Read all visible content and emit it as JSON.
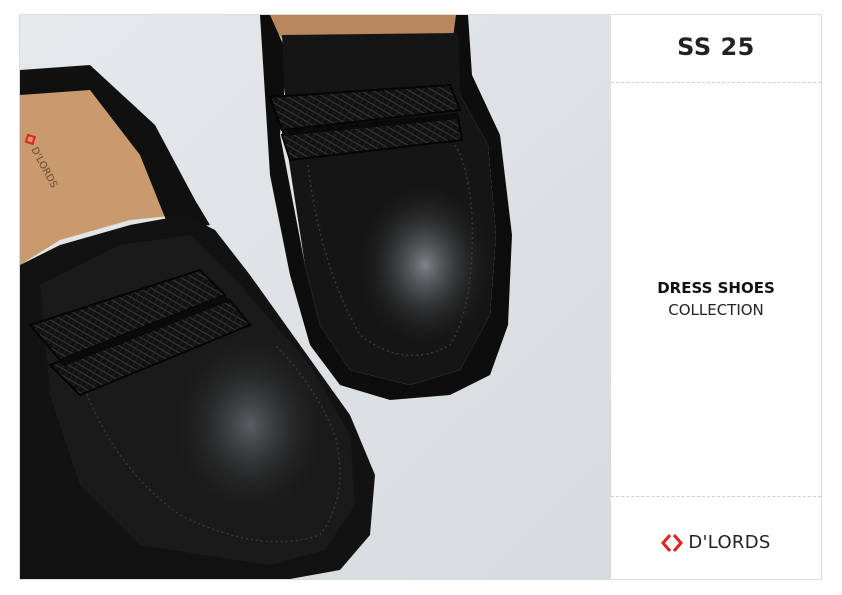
{
  "panel": {
    "season": "SS 25",
    "collection_title": "DRESS SHOES",
    "collection_subtitle": "COLLECTION",
    "brand_name": "D'LORDS",
    "brand_icon": "dlords-logo-icon"
  },
  "photo": {
    "insole_brand": "D'LORDS"
  },
  "colors": {
    "brand_red": "#e2231a",
    "background": "#dfe3e6",
    "leather": "#111111"
  }
}
